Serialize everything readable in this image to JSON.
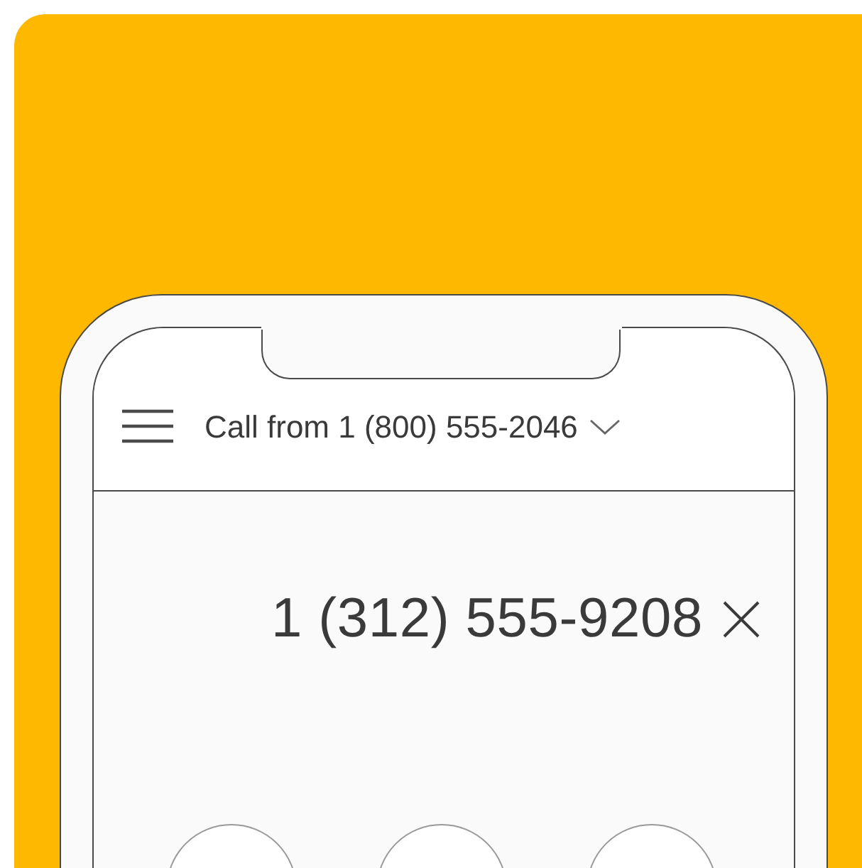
{
  "header": {
    "title": "Call from 1 (800) 555-2046"
  },
  "dialer": {
    "number": "1 (312) 555-9208"
  }
}
